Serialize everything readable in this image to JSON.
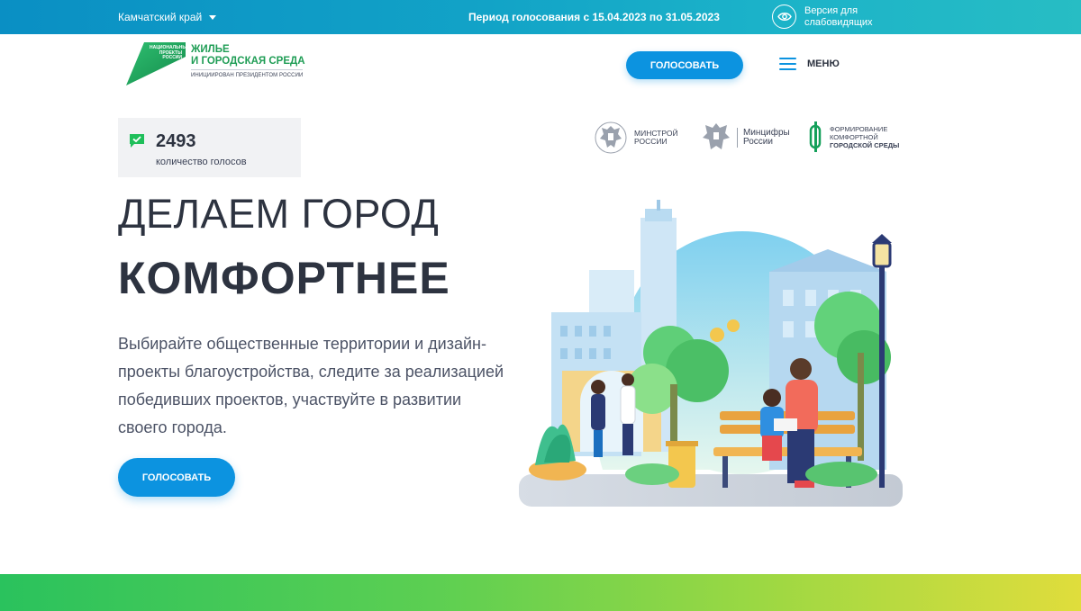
{
  "topbar": {
    "region": "Камчатский край",
    "period": "Период голосования с 15.04.2023 по 31.05.2023",
    "accessibility": "Версия для слабовидящих"
  },
  "logo": {
    "small": [
      "НАЦИОНАЛЬНЫЕ",
      "ПРОЕКТЫ",
      "РОССИИ"
    ],
    "title_line1": "ЖИЛЬЕ",
    "title_line2": "И ГОРОДСКАЯ СРЕДА",
    "subtitle": "ИНИЦИИРОВАН ПРЕЗИДЕНТОМ РОССИИ"
  },
  "header": {
    "vote_button": "ГОЛОСОВАТЬ",
    "menu_label": "МЕНЮ"
  },
  "votes": {
    "count": "2493",
    "label": "количество голосов"
  },
  "partners": [
    {
      "line1": "МИНСТРОЙ",
      "line2": "РОССИИ",
      "line3": ""
    },
    {
      "line1": "Минцифры",
      "line2": "России",
      "line3": ""
    },
    {
      "line1": "ФОРМИРОВАНИЕ",
      "line2": "КОМФОРТНОЙ",
      "line3": "ГОРОДСКОЙ СРЕДЫ"
    }
  ],
  "hero": {
    "line1": "ДЕЛАЕМ ГОРОД",
    "line2": "КОМФОРТНЕЕ",
    "description": "Выбирайте общественные территории и дизайн-проекты благоустройства, следите за реализацией победивших проектов, участвуйте в развитии своего города.",
    "vote_button": "ГОЛОСОВАТЬ"
  },
  "colors": {
    "accent": "#0c93e0",
    "green": "#1f9d55",
    "text": "#2d3340"
  },
  "icons": {
    "region_caret": "caret-down-icon",
    "accessibility": "eye-icon",
    "menu": "hamburger-icon",
    "votes": "check-message-icon"
  }
}
